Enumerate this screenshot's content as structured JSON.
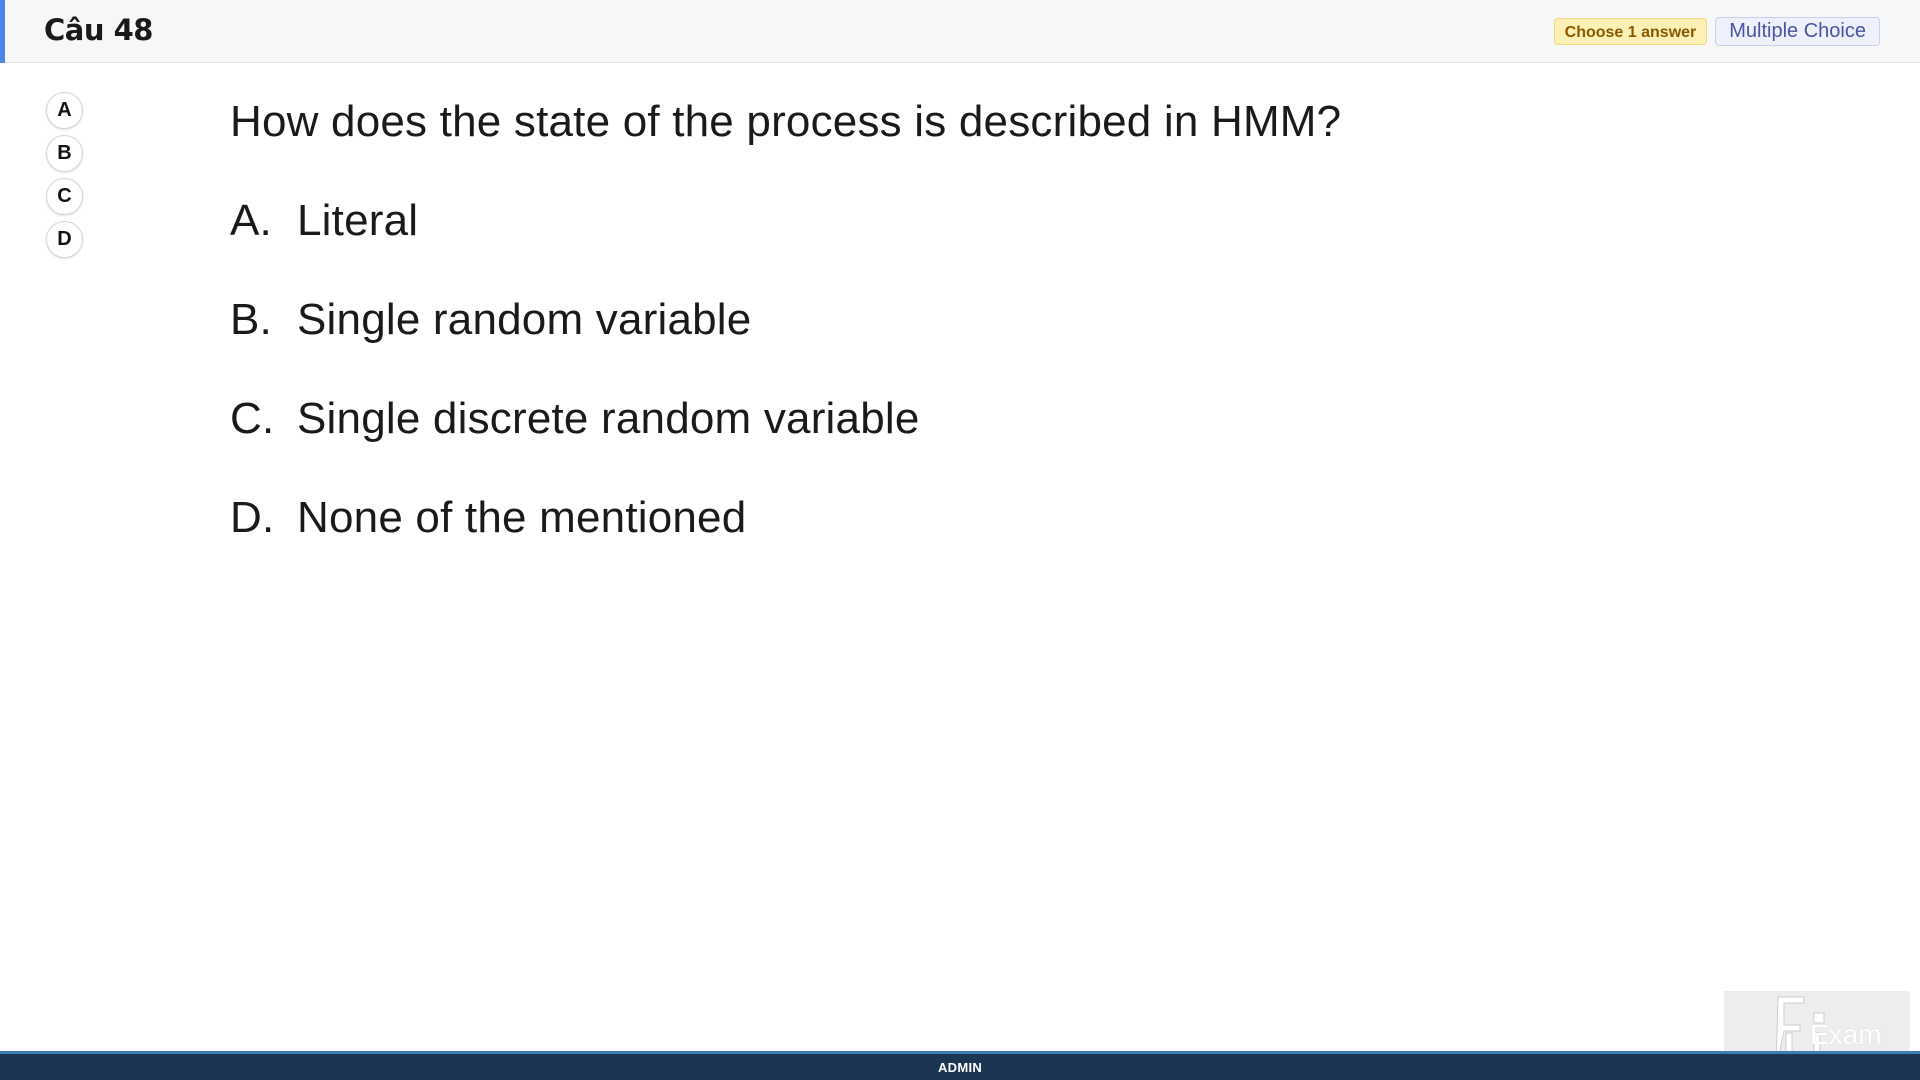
{
  "colors": {
    "accent": "#4a86e8",
    "badge_choose_bg": "#fdf0b6",
    "badge_choose_border": "#f0d77a",
    "badge_choose_text": "#8a5a00",
    "badge_type_bg": "#eef0fb",
    "badge_type_border": "#c9cfee",
    "badge_type_text": "#4b55a8",
    "footer_bg": "#1c3553"
  },
  "header": {
    "question_number": "Câu 48",
    "choose_badge": "Choose 1 answer",
    "type_badge": "Multiple Choice"
  },
  "answers": [
    {
      "label": "A"
    },
    {
      "label": "B"
    },
    {
      "label": "C"
    },
    {
      "label": "D"
    }
  ],
  "question": {
    "text": "How does the state of the process is described in HMM?",
    "options": [
      {
        "letter": "A.",
        "text": "Literal"
      },
      {
        "letter": "B.",
        "text": "Single random variable"
      },
      {
        "letter": "C.",
        "text": "Single discrete random variable"
      },
      {
        "letter": "D.",
        "text": "None of the mentioned"
      }
    ]
  },
  "watermark": {
    "text": "Exam",
    "logo_icon": "fu-logo-icon"
  },
  "footer": {
    "user": "ADMIN"
  }
}
